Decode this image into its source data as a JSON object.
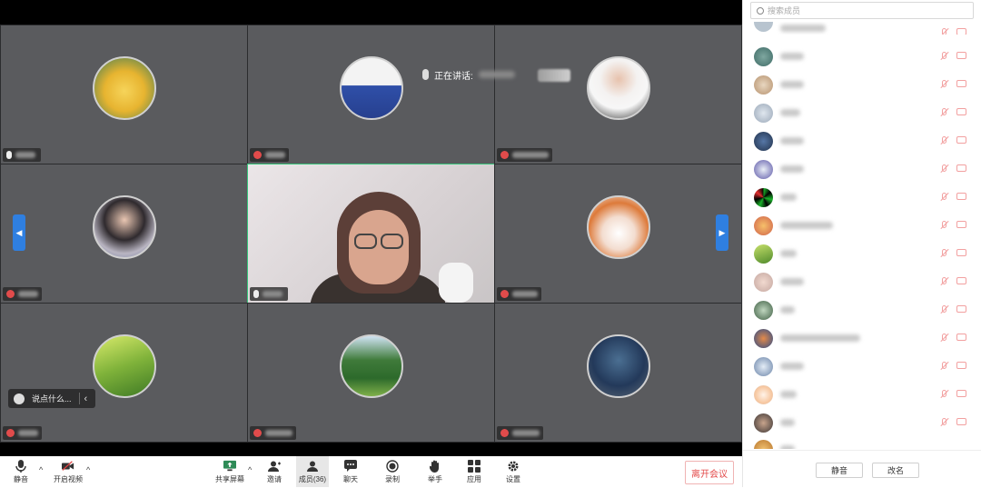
{
  "speaking": {
    "label": "正在讲话:"
  },
  "chat_input": {
    "placeholder": "说点什么..."
  },
  "toolbar": {
    "mute_label": "静音",
    "video_label": "开启视频",
    "share_label": "共享屏幕",
    "invite_label": "邀请",
    "members_label": "成员(36)",
    "chat_label": "聊天",
    "record_label": "录制",
    "raise_hand_label": "举手",
    "apps_label": "应用",
    "settings_label": "设置",
    "leave_label": "离开会议"
  },
  "panel": {
    "search_placeholder": "搜索成员",
    "mute_all_label": "静音",
    "rename_label": "改名"
  },
  "colors": {
    "accent": "#2f7fe0",
    "active_speaker": "#37c47b",
    "leave": "#e34a4a"
  }
}
